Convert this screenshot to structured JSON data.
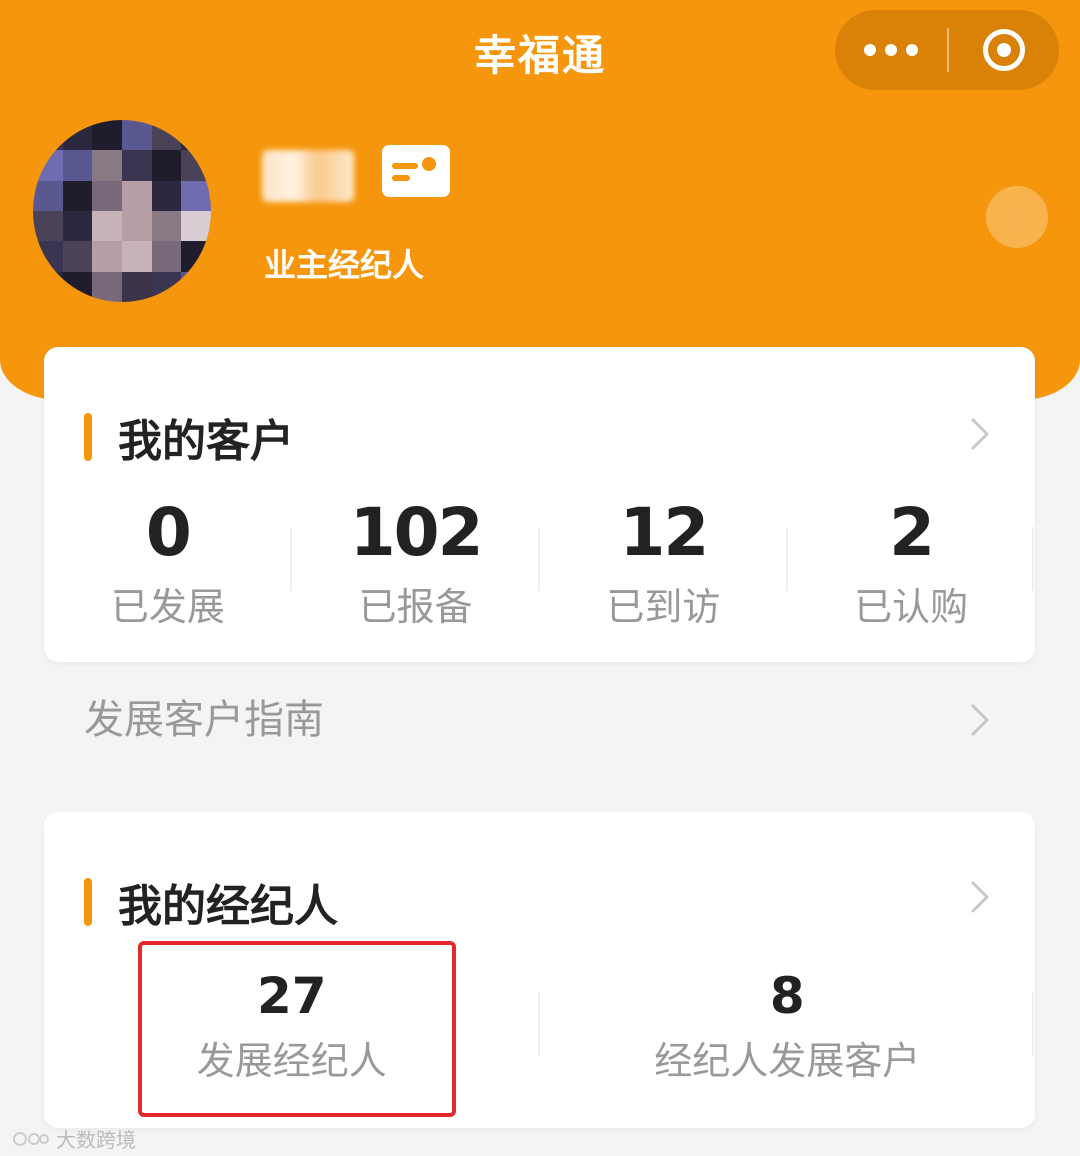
{
  "header": {
    "title": "幸福通",
    "role": "业主经纪人"
  },
  "customers": {
    "title": "我的客户",
    "stats": [
      {
        "value": "0",
        "label": "已发展"
      },
      {
        "value": "102",
        "label": "已报备"
      },
      {
        "value": "12",
        "label": "已到访"
      },
      {
        "value": "2",
        "label": "已认购"
      }
    ]
  },
  "guide": {
    "label": "发展客户指南"
  },
  "agents": {
    "title": "我的经纪人",
    "stats": [
      {
        "value": "27",
        "label": "发展经纪人"
      },
      {
        "value": "8",
        "label": "经纪人发展客户"
      }
    ]
  },
  "watermark": "大数跨境",
  "colors": {
    "brand": "#f5960c",
    "highlight": "#e5282a"
  }
}
